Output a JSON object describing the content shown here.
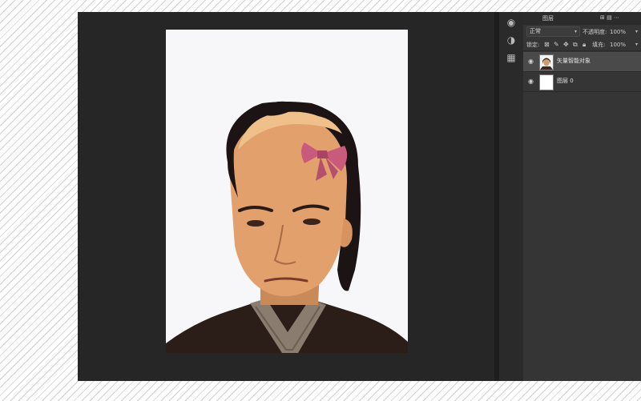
{
  "canvas": {
    "background": "#262626",
    "document_background": "#f7f7f9",
    "bow_color": "#c85a7c"
  },
  "panel": {
    "top_tab_label": "图层",
    "blend_mode": "正常",
    "opacity_label": "不透明度:",
    "opacity_value": "100%",
    "lock_label": "锁定:",
    "fill_label": "填充:",
    "fill_value": "100%"
  },
  "layers": [
    {
      "name": "矢量智能对象",
      "selected": true,
      "visible": true,
      "thumb": "portrait"
    },
    {
      "name": "图层 0",
      "selected": false,
      "visible": true,
      "thumb": "white"
    }
  ],
  "icons": {
    "eye": "eye-icon",
    "lock_transparent": "lock-transparent-icon",
    "lock_paint": "brush-icon",
    "lock_move": "move-icon",
    "lock_artboard": "artboard-icon",
    "lock_all": "lock-icon"
  }
}
